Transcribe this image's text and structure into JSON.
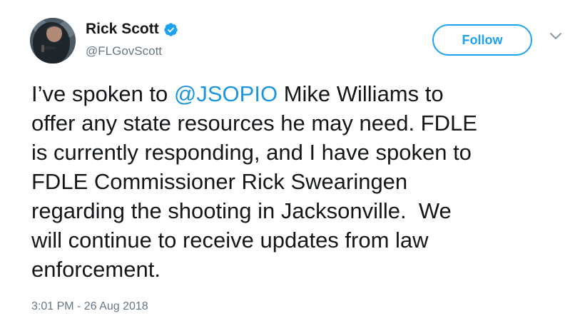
{
  "author": {
    "display_name": "Rick Scott",
    "handle": "@FLGovScott",
    "verified": true,
    "avatar_icon": "profile-photo"
  },
  "follow_button": {
    "label": "Follow"
  },
  "menu": {
    "icon": "chevron-down-icon"
  },
  "tweet": {
    "lines": [
      {
        "pre": "I’ve spoken to ",
        "mention": "@JSOPIO",
        "post": " Mike Williams to"
      },
      {
        "text": "offer any state resources he may need. FDLE"
      },
      {
        "text": "is currently responding, and I have spoken to"
      },
      {
        "text": "FDLE Commissioner Rick Swearingen"
      },
      {
        "text": "regarding the shooting in Jacksonville.  We"
      },
      {
        "text": "will continue to receive updates from law"
      },
      {
        "text": "enforcement."
      }
    ],
    "timestamp": "3:01 PM - 26 Aug 2018"
  },
  "colors": {
    "accent": "#1da1f2",
    "mention": "#1b95e0",
    "secondary_text": "#657786",
    "primary_text": "#14171a"
  }
}
